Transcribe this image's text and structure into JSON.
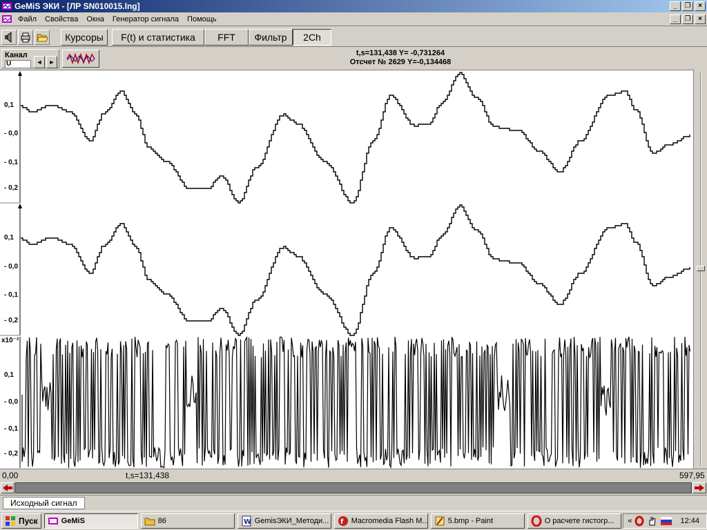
{
  "window": {
    "title": "GeMiS ЭКИ - [ЛР SN010015.lng]",
    "min": "_",
    "max": "❐",
    "close": "×"
  },
  "menu": {
    "items": [
      "Файл",
      "Свойства",
      "Окна",
      "Генератор сигнала",
      "Помощь"
    ]
  },
  "toolbar": {
    "buttons": [
      "Курсоры",
      "F(t) и статистика",
      "FFT",
      "Фильтр",
      "2Ch"
    ],
    "pressed": "2Ch"
  },
  "channel": {
    "label": "Канал",
    "value": "U",
    "prev": "◄",
    "next": "►"
  },
  "readout": {
    "line1": "t,s=131,438  Y= -0,731264",
    "line2": "Отсчет № 2629 Y=-0,134468"
  },
  "plots": {
    "panel1_ticks": [
      "0,1",
      "- 0,0",
      "- 0,1",
      "- 0,2"
    ],
    "panel2_ticks": [
      "0,1",
      "- 0,0",
      "- 0,1",
      "- 0,2"
    ],
    "panel3_ticks": [
      "0,1",
      "- 0,0",
      "- 0,1",
      "- 0,2"
    ],
    "panel3_multiplier": "x10⁻²"
  },
  "xaxis": {
    "start": "0,00",
    "cursor": "t,s=131,438",
    "end": "597,95"
  },
  "tabs": [
    "Исходный сигнал"
  ],
  "taskbar": {
    "start": "Пуск",
    "items": [
      "GeMiS",
      "86",
      "GemisЭКИ_Методи...",
      "Macromedia Flash M...",
      "5.bmp - Paint",
      "О расчете гистогр..."
    ],
    "active": "GeMiS",
    "tray_chevron": "«",
    "clock": "12:44"
  },
  "colors": {
    "titlebar_start": "#0a246a",
    "titlebar_end": "#a6caf0",
    "face": "#d4d0c8",
    "plot_bg": "#ffffff",
    "signal": "#000000",
    "scroll_arrow": "#c00000"
  }
}
